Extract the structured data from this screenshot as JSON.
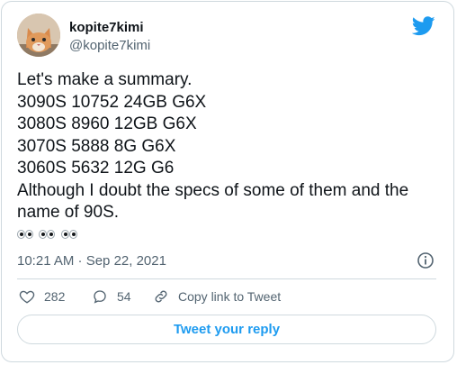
{
  "user": {
    "display_name": "kopite7kimi",
    "handle": "@kopite7kimi",
    "avatar_icon": "cat-avatar"
  },
  "tweet": {
    "lines": [
      "Let's make a summary.",
      "3090S 10752 24GB G6X",
      "3080S 8960 12GB G6X",
      "3070S 5888 8G G6X",
      "3060S 5632 12G G6",
      "Although I doubt the specs of some of them and the name of 90S."
    ],
    "emoji": "eyes-emoji x3",
    "timestamp": "10:21 AM · Sep 22, 2021"
  },
  "actions": {
    "like_count": "282",
    "reply_count": "54",
    "copy_link_label": "Copy link to Tweet"
  },
  "reply_button_label": "Tweet your reply",
  "colors": {
    "accent": "#1d9bf0",
    "like_red": "#f91880",
    "text": "#0f1419",
    "muted": "#536471"
  }
}
